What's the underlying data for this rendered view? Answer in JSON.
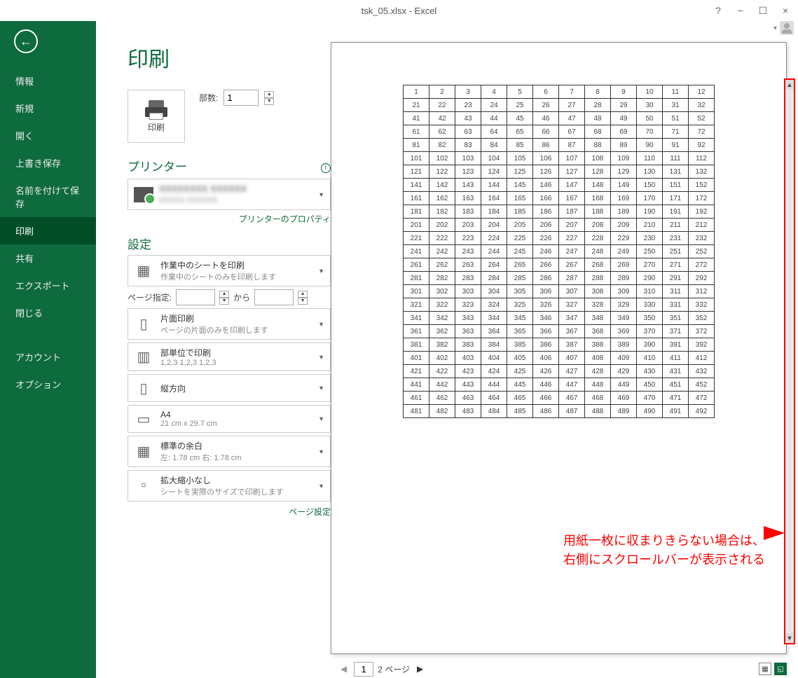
{
  "titlebar": {
    "title": "tsk_05.xlsx - Excel"
  },
  "sidebar": {
    "items": [
      {
        "label": "情報"
      },
      {
        "label": "新規"
      },
      {
        "label": "開く"
      },
      {
        "label": "上書き保存"
      },
      {
        "label": "名前を付けて保存"
      },
      {
        "label": "印刷"
      },
      {
        "label": "共有"
      },
      {
        "label": "エクスポート"
      },
      {
        "label": "閉じる"
      },
      {
        "label": "アカウント"
      },
      {
        "label": "オプション"
      }
    ],
    "activeIndex": 5
  },
  "print": {
    "title": "印刷",
    "button_label": "印刷",
    "copies_label": "部数:",
    "copies_value": "1",
    "printer_header": "プリンター",
    "printer_name": "XXXXXXXX XXXXXX",
    "printer_status": "XXXXX XXXXXX",
    "printer_props_link": "プリンターのプロパティ",
    "settings_header": "設定",
    "page_label": "ページ指定:",
    "from_label": "から",
    "page_setup_link": "ページ設定",
    "settings": [
      {
        "title": "作業中のシートを印刷",
        "sub": "作業中のシートのみを印刷します"
      },
      {
        "title": "片面印刷",
        "sub": "ページの片面のみを印刷します"
      },
      {
        "title": "部単位で印刷",
        "sub": "1,2,3    1,2,3    1,2,3"
      },
      {
        "title": "縦方向",
        "sub": ""
      },
      {
        "title": "A4",
        "sub": "21 cm x 29.7 cm"
      },
      {
        "title": "標準の余白",
        "sub": "左:  1.78 cm    右:  1.78 cm"
      },
      {
        "title": "拡大縮小なし",
        "sub": "シートを実際のサイズで印刷します"
      }
    ]
  },
  "preview": {
    "rows": 25,
    "cols": 12,
    "row_step": 20
  },
  "annotation": {
    "line1": "用紙一枚に収まりきらない場合は、",
    "line2": "右側にスクロールバーが表示される"
  },
  "page_nav": {
    "current": "1",
    "total_label": "2 ページ"
  },
  "chart_data": {
    "type": "table",
    "description": "Print preview shows a 25×12 grid; rows step by 20.",
    "rows": 25,
    "cols": 12,
    "row_step": 20,
    "first_row": [
      1,
      2,
      3,
      4,
      5,
      6,
      7,
      8,
      9,
      10,
      11,
      12
    ],
    "last_row": [
      481,
      482,
      483,
      484,
      485,
      486,
      487,
      488,
      489,
      490,
      491,
      492
    ]
  }
}
